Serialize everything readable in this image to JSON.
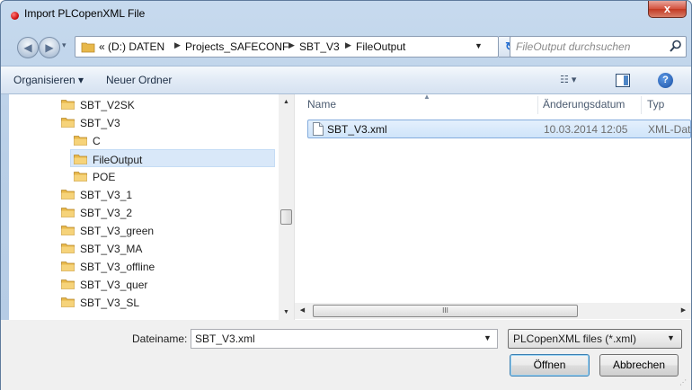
{
  "window": {
    "title": "Import PLCopenXML File",
    "close_label": "x"
  },
  "navigation": {
    "breadcrumb": [
      {
        "label": "« (D:) DATEN"
      },
      {
        "label": "Projects_SAFECONF"
      },
      {
        "label": "SBT_V3"
      },
      {
        "label": "FileOutput"
      }
    ],
    "search_placeholder": "FileOutput durchsuchen"
  },
  "toolbar": {
    "organize_label": "Organisieren ▾",
    "new_folder_label": "Neuer Ordner"
  },
  "tree": {
    "items": [
      {
        "label": "SBT_V2SK",
        "indent": 0,
        "selected": false
      },
      {
        "label": "SBT_V3",
        "indent": 0,
        "selected": false
      },
      {
        "label": "C",
        "indent": 1,
        "selected": false
      },
      {
        "label": "FileOutput",
        "indent": 1,
        "selected": true
      },
      {
        "label": "POE",
        "indent": 1,
        "selected": false
      },
      {
        "label": "SBT_V3_1",
        "indent": 0,
        "selected": false
      },
      {
        "label": "SBT_V3_2",
        "indent": 0,
        "selected": false
      },
      {
        "label": "SBT_V3_green",
        "indent": 0,
        "selected": false
      },
      {
        "label": "SBT_V3_MA",
        "indent": 0,
        "selected": false
      },
      {
        "label": "SBT_V3_offline",
        "indent": 0,
        "selected": false
      },
      {
        "label": "SBT_V3_quer",
        "indent": 0,
        "selected": false
      },
      {
        "label": "SBT_V3_SL",
        "indent": 0,
        "selected": false
      }
    ]
  },
  "file_list": {
    "columns": [
      "Name",
      "Änderungsdatum",
      "Typ"
    ],
    "rows": [
      {
        "name": "SBT_V3.xml",
        "date": "10.03.2014 12:05",
        "type": "XML-Dat"
      }
    ]
  },
  "bottom": {
    "filename_label": "Dateiname:",
    "filename_value": "SBT_V3.xml",
    "filter_value": "PLCopenXML files (*.xml)",
    "open_label": "Öffnen",
    "cancel_label": "Abbrechen"
  },
  "colors": {
    "selection": "#cfe4fa",
    "folder": "#e8b84a",
    "chrome": "#b9cfe7"
  }
}
